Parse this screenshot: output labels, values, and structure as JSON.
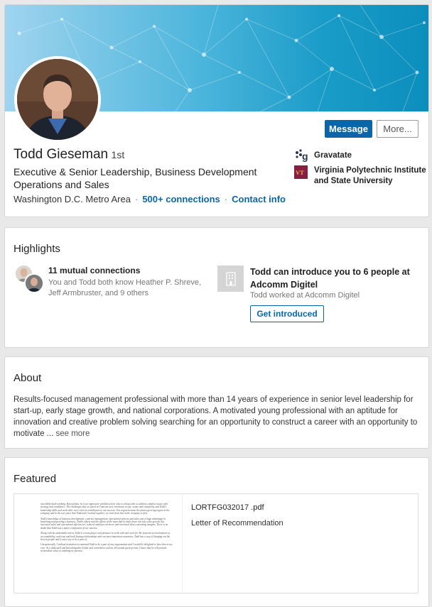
{
  "profile": {
    "name": "Todd Gieseman",
    "degree": "· 1st",
    "headline": "Executive & Senior Leadership, Business Development Operations and Sales",
    "location": "Washington D.C. Metro Area",
    "connections": "500+ connections",
    "contact": "Contact info",
    "message_label": "Message",
    "more_label": "More...",
    "company": "Gravatate",
    "school": "Virginia Polytechnic Institute and State University"
  },
  "highlights": {
    "title": "Highlights",
    "mutual_title": "11 mutual connections",
    "mutual_sub": "You and Todd both know Heather P. Shreve, Jeff Armbruster, and 9 others",
    "intro_title": "Todd can introduce you to 6 people at Adcomm Digitel",
    "intro_sub": "Todd worked at Adcomm Digitel",
    "intro_button": "Get introduced"
  },
  "about": {
    "title": "About",
    "text": "Results-focused management professional with more than 14 years of experience in senior level leadership for start-up, early stage growth, and national corporations. A motivated young professional with an aptitude for innovation and creative problem solving searching for an opportunity to construct a career with an opportunity to motivate",
    "ellipsis": " ... ",
    "see_more": "see more"
  },
  "featured": {
    "title": "Featured",
    "doc_title": "LORTFG032017 .pdf",
    "doc_sub": "Letter of Recommendation",
    "doc_preview": [
      "incredibly hard-working. Beyond that, he is an impressive problem solver who is always able to address complex issues with strategy and confidence. The challenges that we faced at Comcast were enormous in size, scope and complexity and Todd's leadership skills and work ethic were critical contributors to our success. Our region became the fastest growing region in the company and in the two years that Todd and I worked together, we went from last in the company to first.",
      "Todd's knowledge of business development, contract management, operational process and sales was a huge advantage in launching and growing a business. Todd's efforts and the efforts of the team that he built drove not only sales growth, but increased sales and operational efficiencies, reduced employee turnover and increased direct operating margins. There is no doubt that Todd was a major component of our success.",
      "Along with his undeniable talent, Todd is a team player and pleasure to work with and work for. He fostered an environment of accountability, and trust and built lasting relationships with our most important customers. Todd has a way of bringing out the best in people and it was a joy to be a part of.",
      "Unequivocally, I without hesitation recommend Todd to be a part of any organization and I would be delighted to have him in my own. As a dedicated and knowledgeable leader and contributor and an all-around great person, I know that he will provide tremendous value in anything he pursues."
    ]
  },
  "colors": {
    "accent": "#0a66a8",
    "banner_start": "#9fd4ef",
    "banner_end": "#0b8ebc",
    "school_logo": "#861f41"
  },
  "icons": {
    "company": "gravatate-logo-icon",
    "school": "vt-logo-icon",
    "building": "building-icon"
  }
}
